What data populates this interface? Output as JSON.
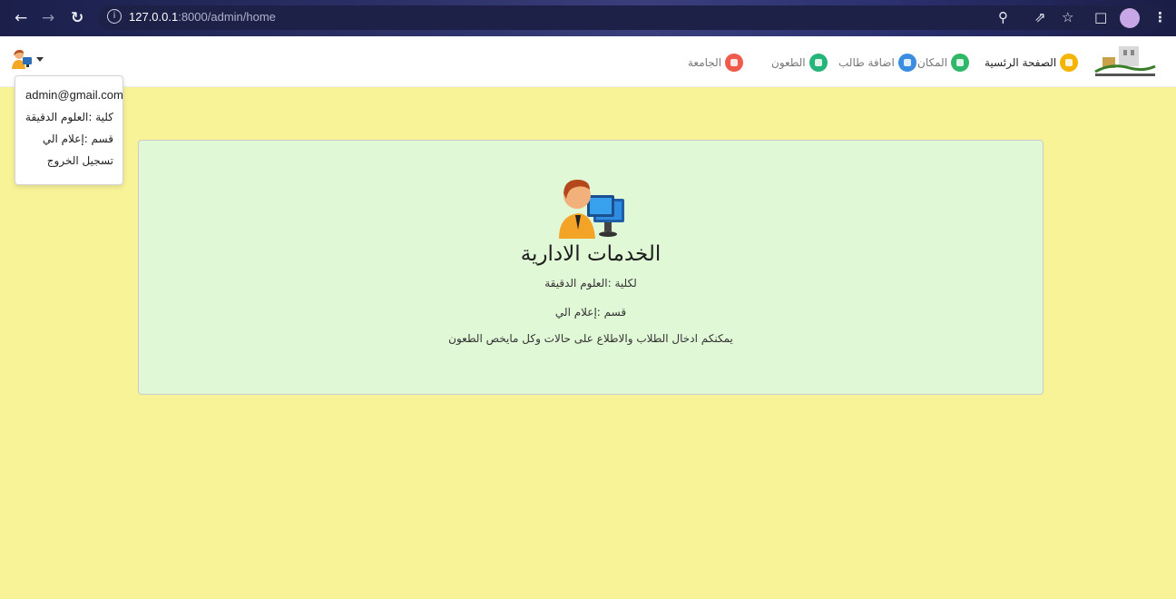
{
  "browser": {
    "url_host": "127.0.0.1",
    "url_rest": ":8000/admin/home",
    "icons": [
      "back-icon",
      "forward-icon",
      "reload-icon",
      "info-icon",
      "zoom-icon",
      "share-icon",
      "star-icon",
      "sidebar-icon",
      "profile-icon",
      "menu-icon"
    ]
  },
  "navbar": {
    "items": [
      {
        "label": "الصفحة الرئسية",
        "icon": "graduation-cap-icon",
        "color": "#f5b400",
        "active": true
      },
      {
        "label": "المكان",
        "icon": "location-pin-icon",
        "color": "#2fb86a"
      },
      {
        "label": "اضافة طالب",
        "icon": "add-user-icon",
        "color": "#3b8de0"
      },
      {
        "label": "الطعون",
        "icon": "clipboard-icon",
        "color": "#25b47a"
      },
      {
        "label": "الجامعة",
        "icon": "building-icon",
        "color": "#ef5a4a"
      }
    ]
  },
  "user_menu": {
    "email": "admin@gmail.com",
    "faculty": "كلية :العلوم الدقيقة",
    "department": "قسم :إعلام الي",
    "logout": "تسجيل الخروج"
  },
  "card": {
    "title": "الخدمات الادارية",
    "faculty": "لكلية :العلوم الدقيقة",
    "department": "قسم :إعلام الي",
    "description": "يمكنكم ادخال الطلاب والاطلاع على حالات وكل مايخص الطعون"
  },
  "colors": {
    "page_bg": "#f9f397",
    "card_bg": "#e1f8d7",
    "navbar_bg": "#ffffff"
  }
}
